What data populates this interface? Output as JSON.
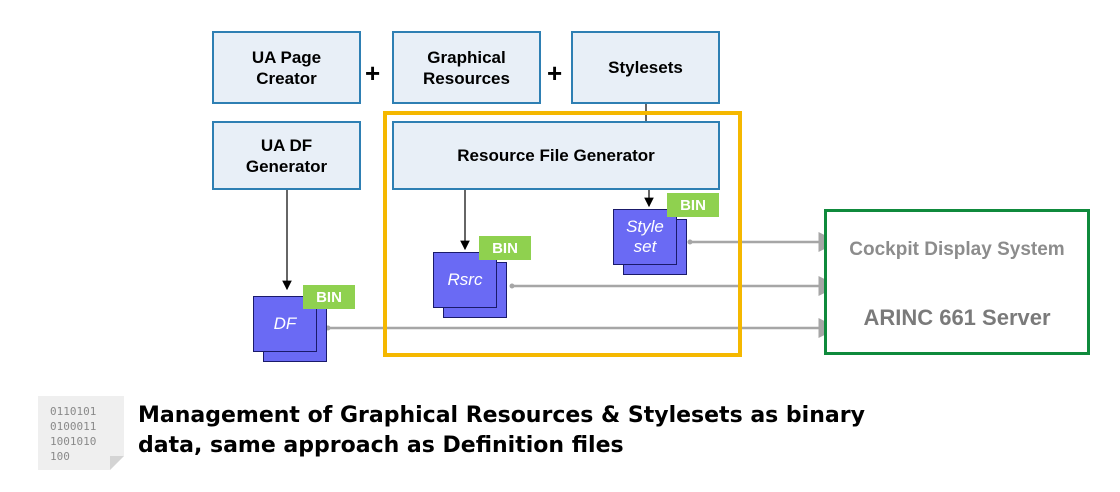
{
  "boxes": {
    "ua_page_creator": "UA Page Creator",
    "graphical_resources": "Graphical Resources",
    "stylesets": "Stylesets",
    "ua_df_generator": "UA DF Generator",
    "resource_file_generator": "Resource File Generator"
  },
  "operators": {
    "plus_1": "+",
    "plus_2": "+"
  },
  "files": {
    "df": {
      "label": "DF",
      "badge": "BIN"
    },
    "rsrc": {
      "label": "Rsrc",
      "badge": "BIN"
    },
    "styleset": {
      "label": "Style set",
      "badge": "BIN"
    }
  },
  "server": {
    "title": "Cockpit Display System",
    "subtitle": "ARINC 661 Server"
  },
  "binary_icon": {
    "text": "0110101\n0100011\n1001010\n100"
  },
  "caption": "Management of Graphical Resources & Stylesets as binary data, same approach as Definition files",
  "colors": {
    "box_fill": "#e8eff7",
    "box_border": "#2e7fb3",
    "generator_frame": "#f5b800",
    "server_border": "#0f8a3c",
    "file_fill": "#6a6af4",
    "bin_badge": "#8fd14f",
    "connector": "#a6a6a6"
  }
}
